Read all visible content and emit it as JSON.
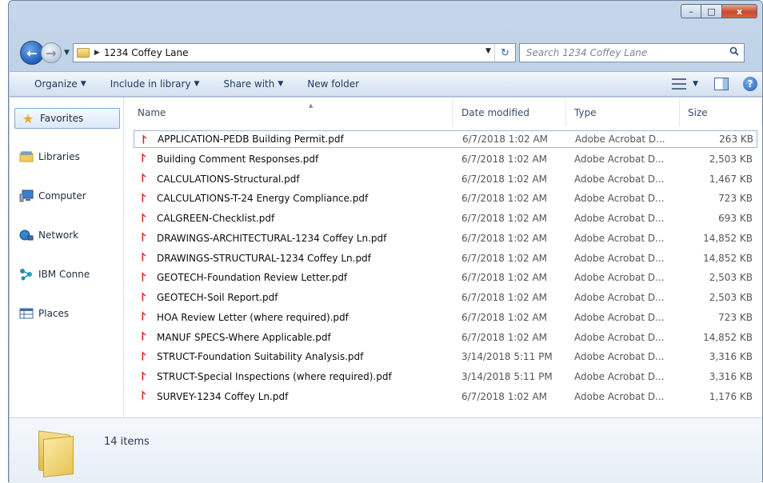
{
  "window": {
    "caption_buttons": {
      "minimize": "–",
      "maximize": "□",
      "close": "x"
    }
  },
  "address_bar": {
    "breadcrumb": "1234 Coffey Lane",
    "search_placeholder": "Search 1234 Coffey Lane"
  },
  "toolbar": {
    "organize": "Organize",
    "include_in_library": "Include in library",
    "share_with": "Share with",
    "new_folder": "New folder"
  },
  "nav_pane": {
    "items": [
      {
        "label": "Favorites",
        "icon": "star-icon"
      },
      {
        "label": "Libraries",
        "icon": "libraries-icon"
      },
      {
        "label": "Computer",
        "icon": "computer-icon"
      },
      {
        "label": "Network",
        "icon": "network-icon"
      },
      {
        "label": "IBM Conne",
        "icon": "ibm-connections-icon"
      },
      {
        "label": "Places",
        "icon": "places-icon"
      }
    ]
  },
  "columns": {
    "name": "Name",
    "date": "Date modified",
    "type": "Type",
    "size": "Size"
  },
  "files": [
    {
      "name": "APPLICATION-PEDB Building Permit.pdf",
      "date": "6/7/2018 1:02 AM",
      "type": "Adobe Acrobat D...",
      "size": "263 KB"
    },
    {
      "name": "Building Comment Responses.pdf",
      "date": "6/7/2018 1:02 AM",
      "type": "Adobe Acrobat D...",
      "size": "2,503 KB"
    },
    {
      "name": "CALCULATIONS-Structural.pdf",
      "date": "6/7/2018 1:02 AM",
      "type": "Adobe Acrobat D...",
      "size": "1,467 KB"
    },
    {
      "name": "CALCULATIONS-T-24 Energy Compliance.pdf",
      "date": "6/7/2018 1:02 AM",
      "type": "Adobe Acrobat D...",
      "size": "723 KB"
    },
    {
      "name": "CALGREEN-Checklist.pdf",
      "date": "6/7/2018 1:02 AM",
      "type": "Adobe Acrobat D...",
      "size": "693 KB"
    },
    {
      "name": "DRAWINGS-ARCHITECTURAL-1234 Coffey Ln.pdf",
      "date": "6/7/2018 1:02 AM",
      "type": "Adobe Acrobat D...",
      "size": "14,852 KB"
    },
    {
      "name": "DRAWINGS-STRUCTURAL-1234 Coffey Ln.pdf",
      "date": "6/7/2018 1:02 AM",
      "type": "Adobe Acrobat D...",
      "size": "14,852 KB"
    },
    {
      "name": "GEOTECH-Foundation Review Letter.pdf",
      "date": "6/7/2018 1:02 AM",
      "type": "Adobe Acrobat D...",
      "size": "2,503 KB"
    },
    {
      "name": "GEOTECH-Soil Report.pdf",
      "date": "6/7/2018 1:02 AM",
      "type": "Adobe Acrobat D...",
      "size": "2,503 KB"
    },
    {
      "name": "HOA Review Letter (where required).pdf",
      "date": "6/7/2018 1:02 AM",
      "type": "Adobe Acrobat D...",
      "size": "723 KB"
    },
    {
      "name": "MANUF SPECS-Where Applicable.pdf",
      "date": "6/7/2018 1:02 AM",
      "type": "Adobe Acrobat D...",
      "size": "14,852 KB"
    },
    {
      "name": "STRUCT-Foundation Suitability Analysis.pdf",
      "date": "3/14/2018 5:11 PM",
      "type": "Adobe Acrobat D...",
      "size": "3,316 KB"
    },
    {
      "name": "STRUCT-Special Inspections (where required).pdf",
      "date": "3/14/2018 5:11 PM",
      "type": "Adobe Acrobat D...",
      "size": "3,316 KB"
    },
    {
      "name": "SURVEY-1234 Coffey Ln.pdf",
      "date": "6/7/2018 1:02 AM",
      "type": "Adobe Acrobat D...",
      "size": "1,176 KB"
    }
  ],
  "details_pane": {
    "item_count": "14 items"
  },
  "colors": {
    "toolbar_text": "#1e3c63",
    "pdf_red": "#d52a1e",
    "selection_border": "#9ab7d8"
  }
}
